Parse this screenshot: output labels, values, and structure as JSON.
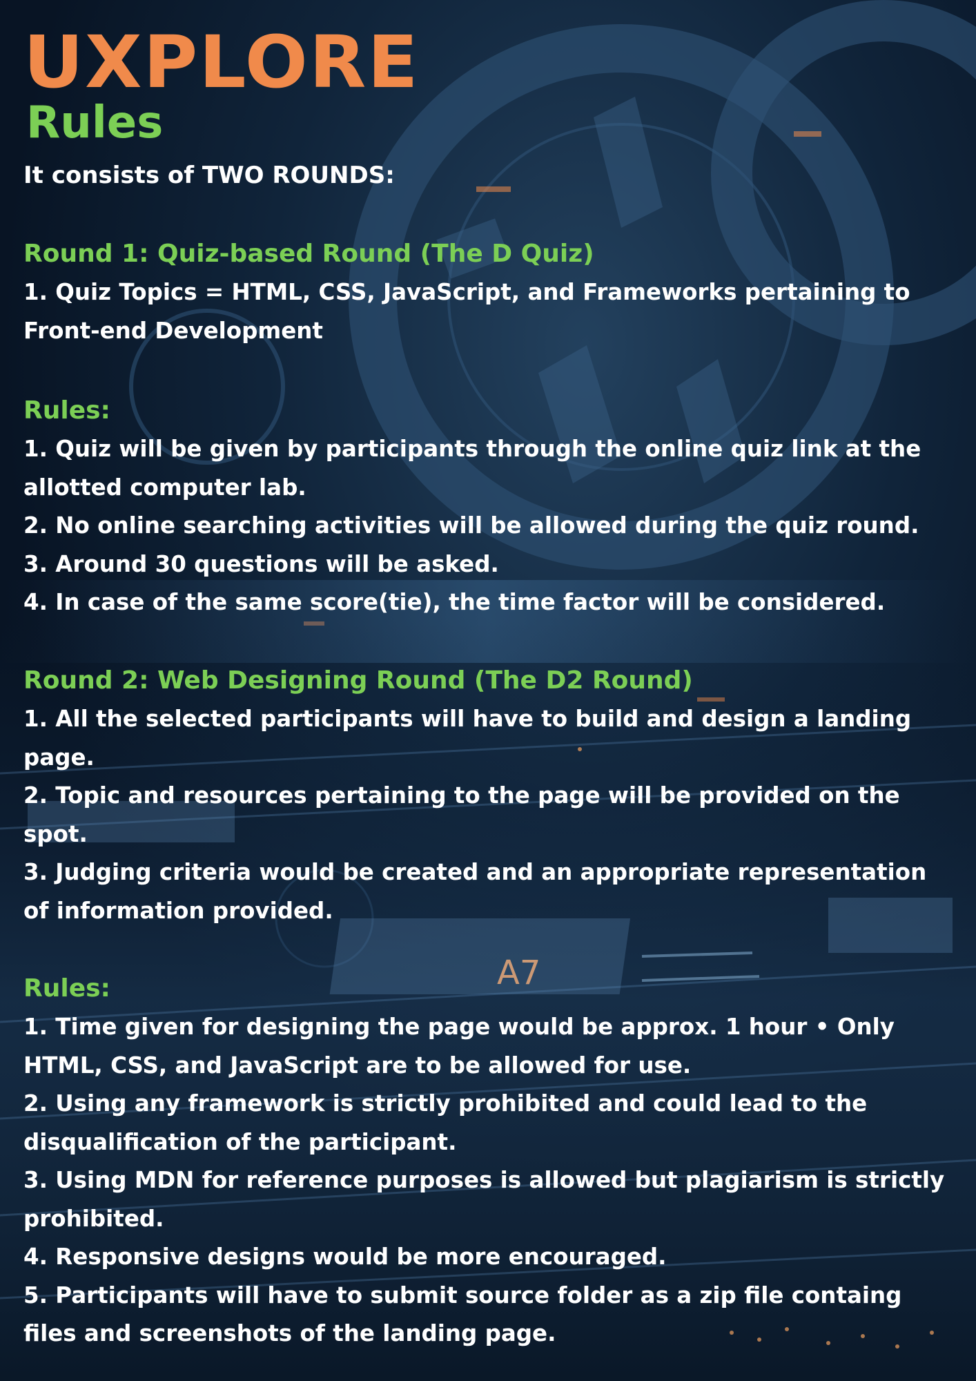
{
  "logo": {
    "text": "UXPLORE"
  },
  "subtitle": "Rules",
  "intro": "It consists of TWO ROUNDS:",
  "round1": {
    "title": "Round 1: Quiz-based Round (The D Quiz)",
    "items": [
      "1. Quiz Topics = HTML, CSS, JavaScript, and Frameworks pertaining to Front-end Development"
    ]
  },
  "rules1": {
    "title": "Rules:",
    "items": [
      "1. Quiz will be given by participants through the online quiz link at the allotted computer lab.",
      "2. No online searching activities will be allowed during the quiz round.",
      "3. Around 30 questions will be asked.",
      "4. In case of the same score(tie), the time factor will be considered."
    ]
  },
  "round2": {
    "title": "Round 2: Web Designing Round (The D2 Round)",
    "items": [
      "1. All the selected participants will have to build and design a landing page.",
      "2. Topic and resources pertaining to the page will be provided on the spot.",
      "3. Judging criteria would be created and an appropriate representation of information provided."
    ]
  },
  "rules2": {
    "title": "Rules:",
    "items": [
      "1. Time given for designing the page would be approx. 1 hour • Only HTML, CSS, and JavaScript are to be allowed for use.",
      "2. Using any framework is strictly prohibited and could lead to the disqualification of the participant.",
      "3. Using MDN for reference purposes is allowed but plagiarism is strictly prohibited.",
      "4. Responsive designs would be more encouraged.",
      "5. Participants will have to submit source folder as a zip file containg files and screenshots of the landing page."
    ]
  },
  "background_label": "A7",
  "colors": {
    "logo": "#f08a4b",
    "heading": "#7ccf55",
    "text": "#ffffff",
    "background": "#0b1a2c"
  }
}
